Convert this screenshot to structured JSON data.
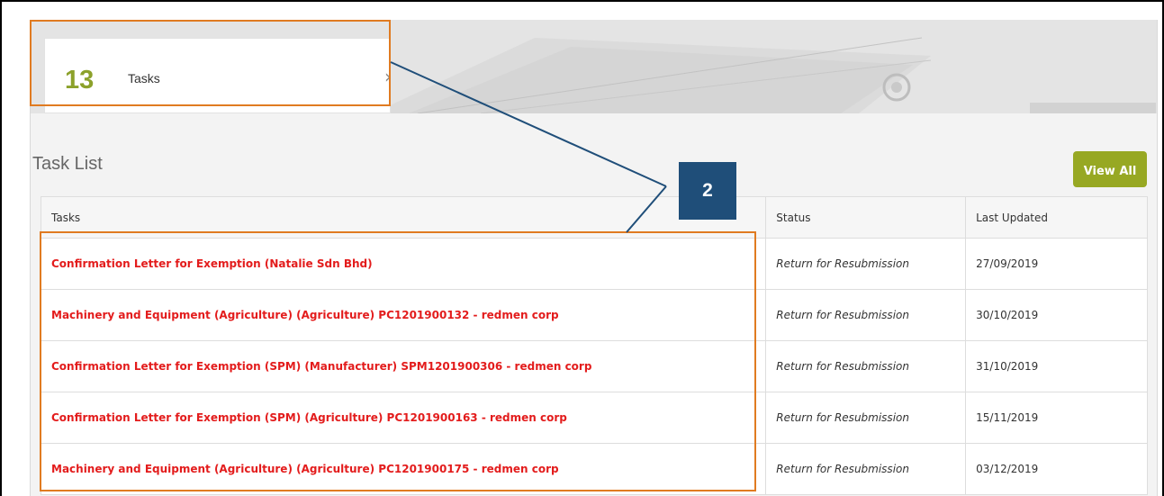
{
  "tasks_card": {
    "count": "13",
    "label": "Tasks",
    "chevron": "›"
  },
  "task_list": {
    "title": "Task List",
    "view_all_label": "View All",
    "columns": [
      "Tasks",
      "Status",
      "Last Updated"
    ],
    "rows": [
      {
        "task": "Confirmation Letter for Exemption (Natalie Sdn Bhd)",
        "status": "Return for Resubmission",
        "last_updated": "27/09/2019"
      },
      {
        "task": "Machinery and Equipment (Agriculture) (Agriculture) PC1201900132 - redmen corp",
        "status": "Return for Resubmission",
        "last_updated": "30/10/2019"
      },
      {
        "task": "Confirmation Letter for Exemption (SPM) (Manufacturer) SPM1201900306 - redmen corp",
        "status": "Return for Resubmission",
        "last_updated": "31/10/2019"
      },
      {
        "task": "Confirmation Letter for Exemption (SPM) (Agriculture) PC1201900163 - redmen corp",
        "status": "Return for Resubmission",
        "last_updated": "15/11/2019"
      },
      {
        "task": "Machinery and Equipment (Agriculture) (Agriculture) PC1201900175 - redmen corp",
        "status": "Return for Resubmission",
        "last_updated": "03/12/2019"
      }
    ]
  },
  "callout": {
    "number": "2"
  },
  "colors": {
    "accent_green": "#97a823",
    "count_green": "#8ca12b",
    "task_link_red": "#e31c1c",
    "highlight_orange": "#e07b21",
    "callout_blue": "#1f4e79"
  }
}
